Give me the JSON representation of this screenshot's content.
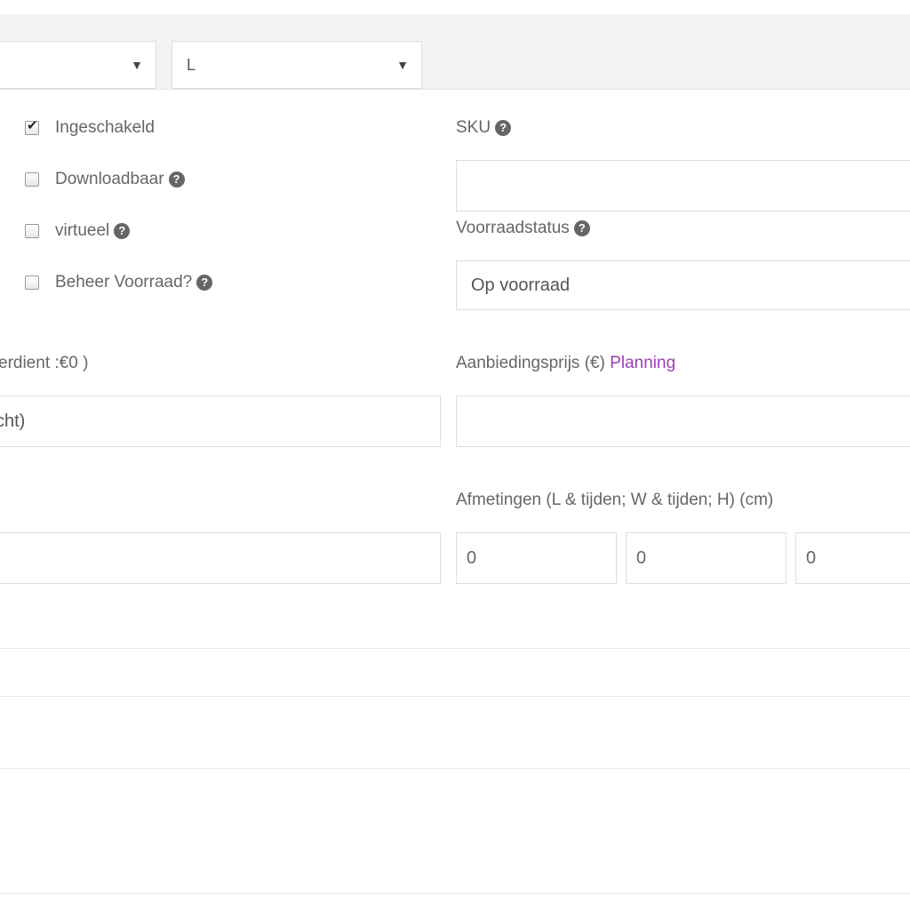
{
  "top_bar": {
    "select1_value": "",
    "select2_value": "L",
    "arrow_glyph": "▼"
  },
  "options": [
    {
      "label": "Ingeschakeld",
      "checked": true,
      "has_help": false
    },
    {
      "label": "Downloadbaar",
      "checked": false,
      "has_help": true
    },
    {
      "label": "virtueel",
      "checked": false,
      "has_help": true
    },
    {
      "label": "Beheer Voorraad?",
      "checked": false,
      "has_help": true
    }
  ],
  "sku": {
    "label": "SKU",
    "value": ""
  },
  "stock_status": {
    "label": "Voorraadstatus",
    "value": "Op voorraad"
  },
  "regular_price": {
    "label_fragment": "erdient :€0 )",
    "value_fragment": "cht)"
  },
  "sale_price": {
    "label": "Aanbiedingsprijs (€)",
    "link": "Planning",
    "value": ""
  },
  "weight": {
    "value": ""
  },
  "dimensions": {
    "label": "Afmetingen (L & tijden; W & tijden; H) (cm)",
    "length_placeholder": "0",
    "width_placeholder": "0",
    "height_placeholder": "0"
  },
  "help_glyph": "?",
  "colors": {
    "link": "#9b3fb7",
    "topbar_bg": "#f4f4f4",
    "border": "#dddddd"
  }
}
